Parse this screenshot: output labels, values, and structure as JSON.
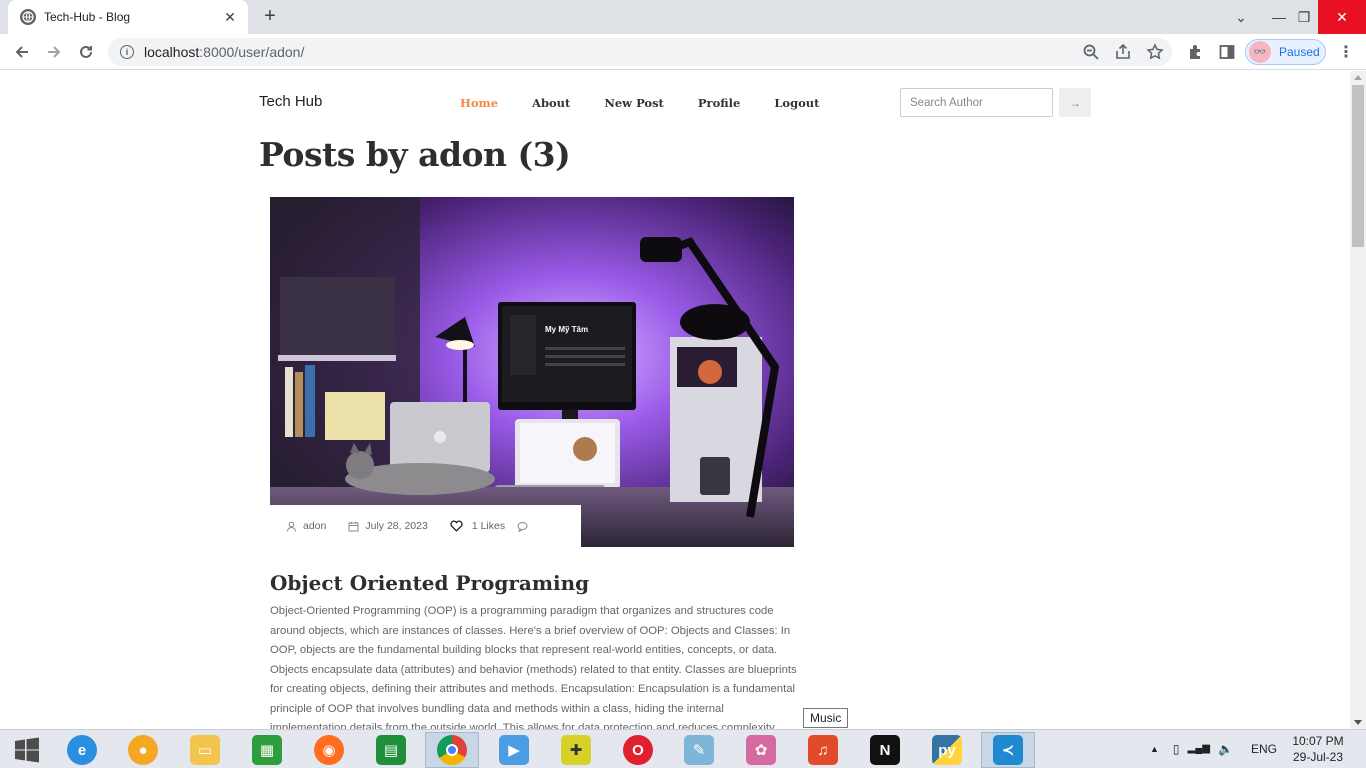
{
  "browser": {
    "tab_title": "Tech-Hub - Blog",
    "new_tab_label": "+",
    "url_host": "localhost",
    "url_rest": ":8000/user/adon/",
    "profile_status": "Paused"
  },
  "site": {
    "brand": "Tech Hub",
    "nav": [
      "Home",
      "About",
      "New Post",
      "Profile",
      "Logout"
    ],
    "active_nav": "Home",
    "search_placeholder": "Search Author",
    "search_button_icon": "arrow-right-icon"
  },
  "page": {
    "heading": "Posts by adon (3)"
  },
  "post": {
    "author": "adon",
    "date": "July 28, 2023",
    "likes": "1 Likes",
    "title": "Object Oriented Programing",
    "body": "Object-Oriented Programming (OOP) is a programming paradigm that organizes and structures code around objects, which are instances of classes. Here's a brief overview of OOP: Objects and Classes: In OOP, objects are the fundamental building blocks that represent real-world entities, concepts, or data. Objects encapsulate data (attributes) and behavior (methods) related to that entity. Classes are blueprints for creating objects, defining their attributes and methods. Encapsulation: Encapsulation is a fundamental principle of OOP that involves bundling data and methods within a class, hiding the internal implementation details from the outside world. This allows for data protection and reduces complexity.",
    "image_screen_text": "My Mỹ Tâm"
  },
  "taskbar": {
    "tooltip": "Music",
    "language": "ENG",
    "time": "10:07 PM",
    "date": "29-Jul-23",
    "apps": [
      "start",
      "internet-explorer",
      "media-player",
      "file-explorer",
      "calculator",
      "firefox",
      "store",
      "chrome",
      "video-player",
      "installer",
      "opera",
      "notepad",
      "photo-app",
      "music",
      "need-for-speed",
      "python",
      "vscode"
    ]
  },
  "colors": {
    "accent_orange": "#f48840",
    "heading": "#2e2e2e",
    "body_text": "#666666",
    "tab_bg": "#dee1e6",
    "close_red": "#e81123"
  }
}
